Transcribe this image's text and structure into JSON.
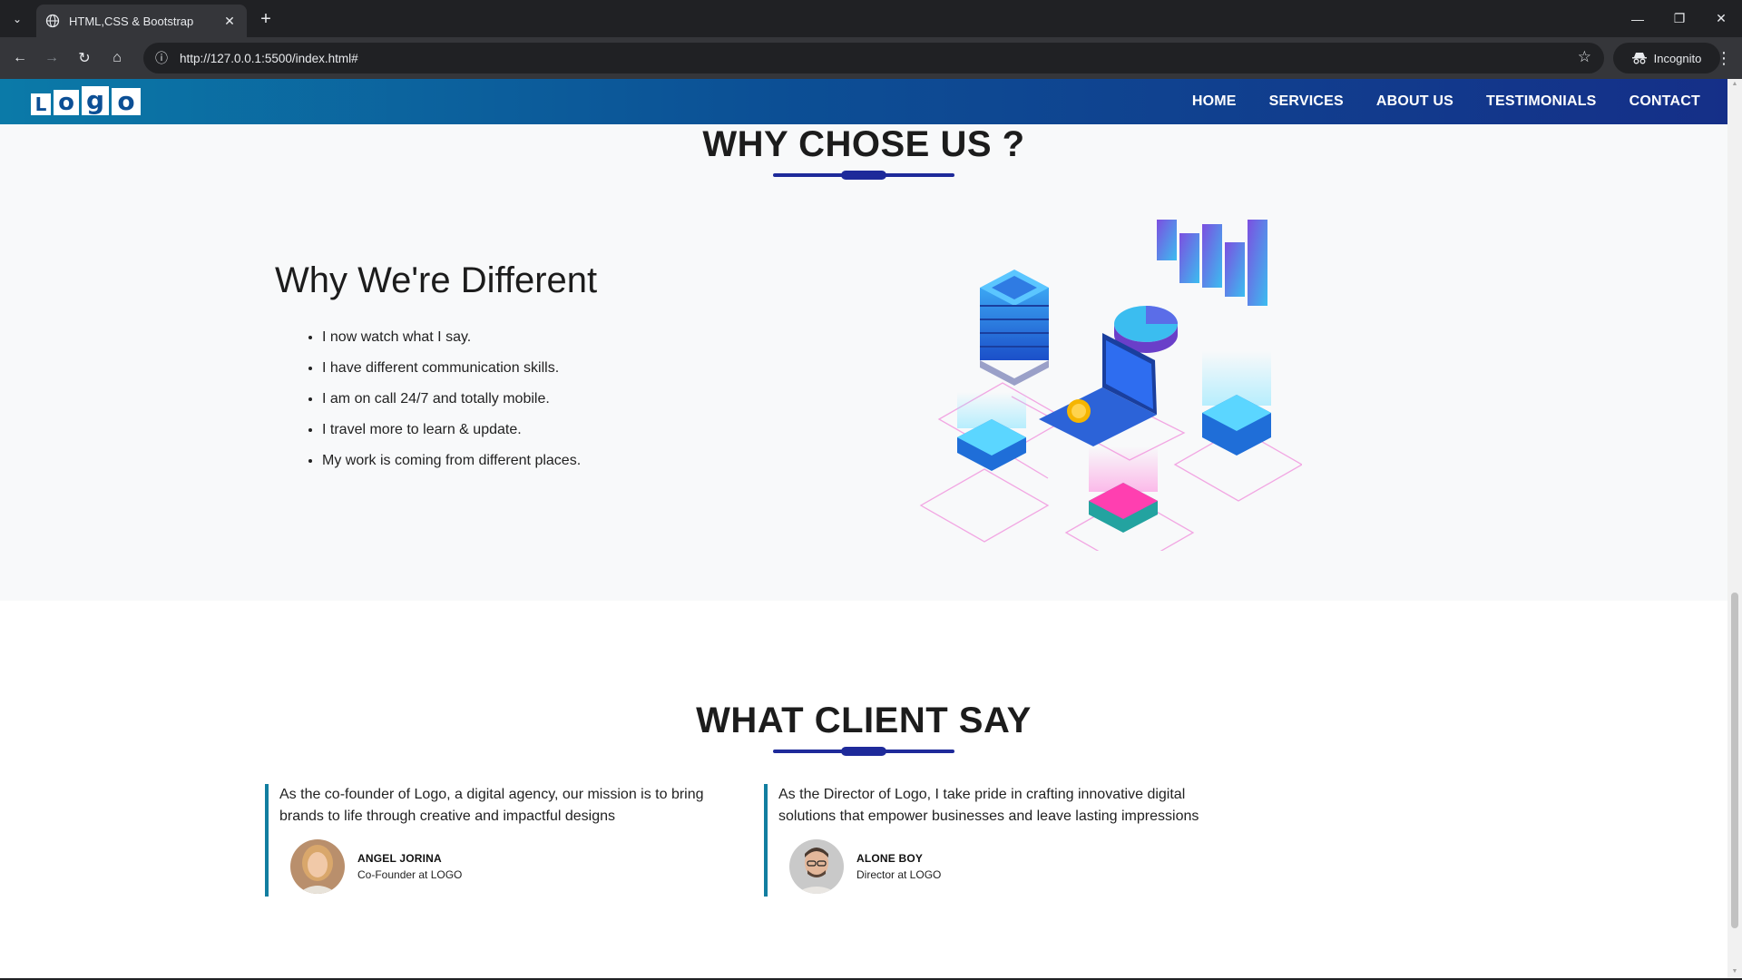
{
  "browser": {
    "tab_title": "HTML,CSS & Bootstrap",
    "url": "http://127.0.0.1:5500/index.html#",
    "incognito_label": "Incognito"
  },
  "site": {
    "logo_letters": [
      "L",
      "o",
      "g",
      "o"
    ],
    "nav": [
      {
        "label": "HOME"
      },
      {
        "label": "SERVICES"
      },
      {
        "label": "ABOUT US"
      },
      {
        "label": "TESTIMONIALS"
      },
      {
        "label": "CONTACT"
      }
    ]
  },
  "why": {
    "title": "WHY CHOSE US ?",
    "heading": "Why We're Different",
    "points": [
      "I now watch what I say.",
      "I have different communication skills.",
      "I am on call 24/7 and totally mobile.",
      "I travel more to learn & update.",
      "My work is coming from different places."
    ]
  },
  "clients": {
    "title": "WHAT CLIENT SAY",
    "testimonials": [
      {
        "quote": "As the co-founder of Logo, a digital agency, our mission is to bring brands to life through creative and impactful designs",
        "name": "ANGEL JORINA",
        "role": "Co-Founder at LOGO"
      },
      {
        "quote": "As the Director of Logo, I take pride in crafting innovative digital solutions that empower businesses and leave lasting impressions",
        "name": "ALONE BOY",
        "role": "Director at LOGO"
      }
    ]
  },
  "colors": {
    "nav_gradient_start": "#0b7aa8",
    "nav_gradient_end": "#152f88",
    "accent_underline": "#1e2a9a",
    "testimonial_border": "#127ea0"
  }
}
